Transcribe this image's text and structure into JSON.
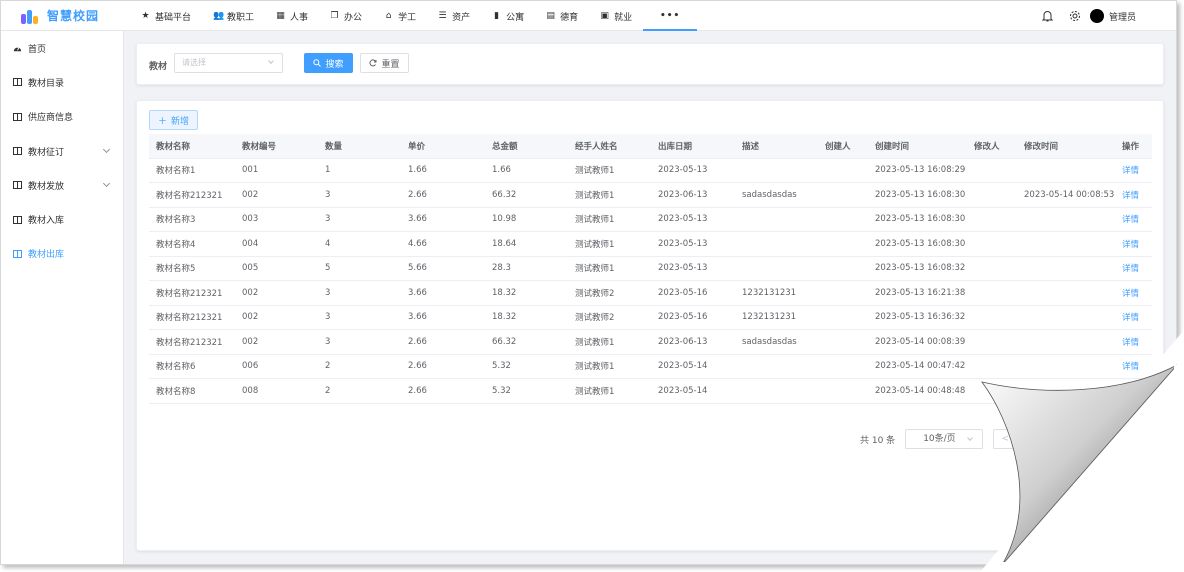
{
  "app": {
    "title": "智慧校园"
  },
  "nav": {
    "items": [
      {
        "label": "基础平台",
        "icon": "star-icon"
      },
      {
        "label": "教职工",
        "icon": "users-icon"
      },
      {
        "label": "人事",
        "icon": "grid-icon"
      },
      {
        "label": "办公",
        "icon": "docs-icon"
      },
      {
        "label": "学工",
        "icon": "bus-icon"
      },
      {
        "label": "资产",
        "icon": "list-icon"
      },
      {
        "label": "公寓",
        "icon": "building-icon"
      },
      {
        "label": "德育",
        "icon": "table-icon"
      },
      {
        "label": "就业",
        "icon": "file-icon"
      }
    ],
    "more": "•••"
  },
  "header": {
    "user": "管理员"
  },
  "sidebar": {
    "items": [
      {
        "label": "首页"
      },
      {
        "label": "教材目录"
      },
      {
        "label": "供应商信息"
      },
      {
        "label": "教材征订"
      },
      {
        "label": "教材发放"
      },
      {
        "label": "教材入库"
      },
      {
        "label": "教材出库"
      }
    ]
  },
  "search": {
    "label": "教材",
    "placeholder": "请选择",
    "search_btn": "搜索",
    "reset_btn": "重置"
  },
  "toolbar": {
    "add_btn": "新增"
  },
  "table": {
    "columns": [
      "教材名称",
      "教材编号",
      "数量",
      "单价",
      "总金额",
      "经手人姓名",
      "出库日期",
      "描述",
      "创建人",
      "创建时间",
      "修改人",
      "修改时间",
      "操作"
    ],
    "rows": [
      [
        "教材名称1",
        "001",
        "1",
        "1.66",
        "1.66",
        "测试教师1",
        "2023-05-13",
        "",
        "",
        "2023-05-13 16:08:29",
        "",
        "",
        "详情"
      ],
      [
        "教材名称212321",
        "002",
        "3",
        "2.66",
        "66.32",
        "测试教师1",
        "2023-06-13",
        "sadasdasdas",
        "",
        "2023-05-13 16:08:30",
        "",
        "2023-05-14 00:08:53",
        "详情"
      ],
      [
        "教材名称3",
        "003",
        "3",
        "3.66",
        "10.98",
        "测试教师1",
        "2023-05-13",
        "",
        "",
        "2023-05-13 16:08:30",
        "",
        "",
        "详情"
      ],
      [
        "教材名称4",
        "004",
        "4",
        "4.66",
        "18.64",
        "测试教师1",
        "2023-05-13",
        "",
        "",
        "2023-05-13 16:08:30",
        "",
        "",
        "详情"
      ],
      [
        "教材名称5",
        "005",
        "5",
        "5.66",
        "28.3",
        "测试教师1",
        "2023-05-13",
        "",
        "",
        "2023-05-13 16:08:32",
        "",
        "",
        "详情"
      ],
      [
        "教材名称212321",
        "002",
        "3",
        "3.66",
        "18.32",
        "测试教师2",
        "2023-05-16",
        "1232131231",
        "",
        "2023-05-13 16:21:38",
        "",
        "",
        "详情"
      ],
      [
        "教材名称212321",
        "002",
        "3",
        "3.66",
        "18.32",
        "测试教师2",
        "2023-05-16",
        "1232131231",
        "",
        "2023-05-13 16:36:32",
        "",
        "",
        "详情"
      ],
      [
        "教材名称212321",
        "002",
        "3",
        "2.66",
        "66.32",
        "测试教师1",
        "2023-06-13",
        "sadasdasdas",
        "",
        "2023-05-14 00:08:39",
        "",
        "",
        "详情"
      ],
      [
        "教材名称6",
        "006",
        "2",
        "2.66",
        "5.32",
        "测试教师1",
        "2023-05-14",
        "",
        "",
        "2023-05-14 00:47:42",
        "",
        "",
        "详情"
      ],
      [
        "教材名称8",
        "008",
        "2",
        "2.66",
        "5.32",
        "测试教师1",
        "2023-05-14",
        "",
        "",
        "2023-05-14 00:48:48",
        "",
        "",
        ""
      ]
    ]
  },
  "pager": {
    "total": "共 10 条",
    "page_size": "10条/页",
    "prev": "<"
  },
  "colors": {
    "accent": "#409eff",
    "bg": "#f0f2f5"
  }
}
